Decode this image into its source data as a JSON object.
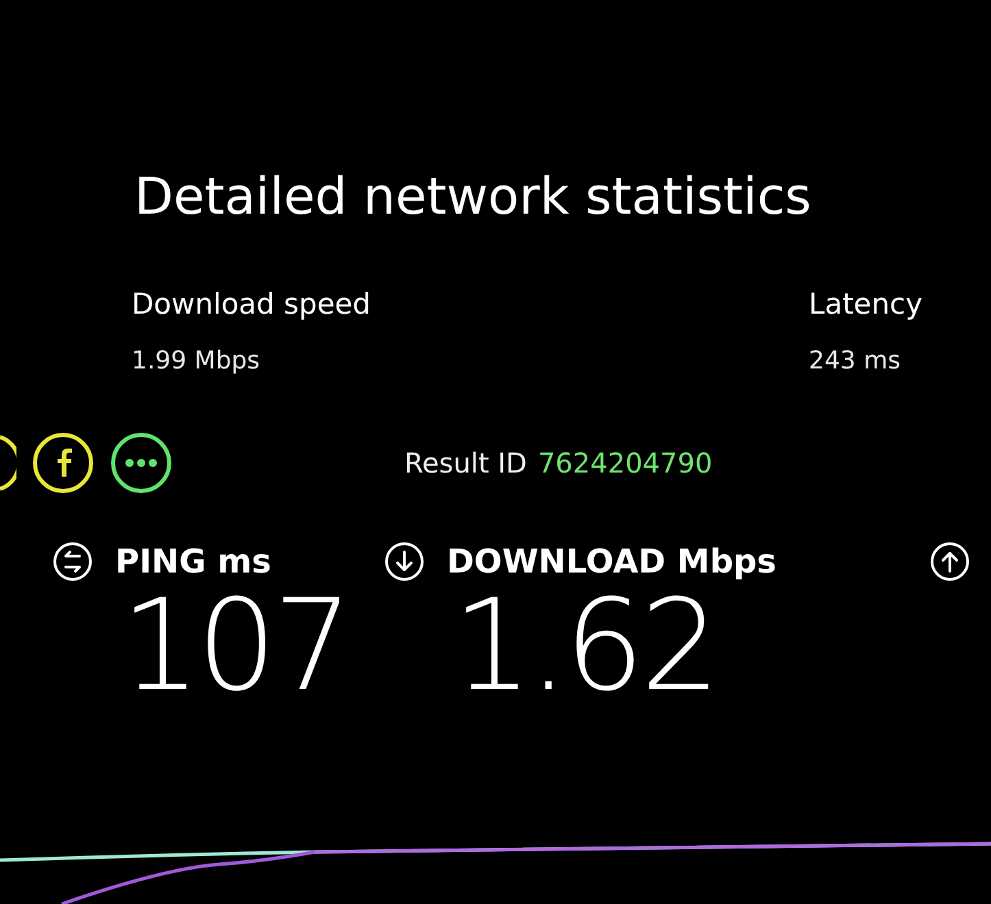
{
  "title": "Detailed network statistics",
  "stats": [
    {
      "label": "Download speed",
      "value": "1.99 Mbps"
    },
    {
      "label": "Latency",
      "value": "243 ms"
    }
  ],
  "share_buttons": [
    {
      "kind": "cut",
      "color": "#e8e63a"
    },
    {
      "kind": "f",
      "color": "#e8e63a"
    },
    {
      "kind": "more",
      "color": "#5fe36a"
    }
  ],
  "result": {
    "label": "Result ID",
    "id": "7624204790"
  },
  "metrics": [
    {
      "kind": "ping",
      "label": "PING ms",
      "value": "107"
    },
    {
      "kind": "download",
      "label": "DOWNLOAD Mbps",
      "value": "1.62"
    },
    {
      "kind": "upload"
    }
  ]
}
